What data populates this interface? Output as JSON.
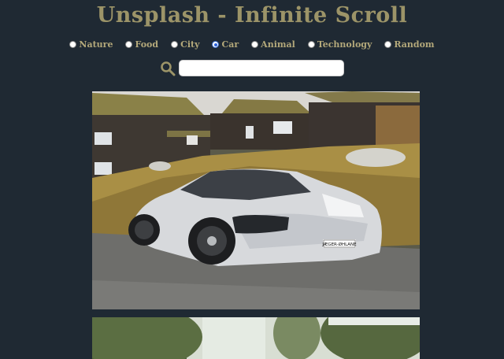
{
  "header": {
    "title": "Unsplash - Infinite Scroll"
  },
  "categories": {
    "items": [
      {
        "label": "Nature",
        "checked": false
      },
      {
        "label": "Food",
        "checked": false
      },
      {
        "label": "City",
        "checked": false
      },
      {
        "label": "Car",
        "checked": true
      },
      {
        "label": "Animal",
        "checked": false
      },
      {
        "label": "Technology",
        "checked": false
      },
      {
        "label": "Random",
        "checked": false
      }
    ]
  },
  "search": {
    "value": "",
    "placeholder": "",
    "icon": "search-icon"
  },
  "photos": [
    {
      "subject": "car-photo",
      "license_plate": "JÆGER-ØHLANE"
    },
    {
      "subject": "trees-photo"
    }
  ],
  "colors": {
    "background": "#1f2933",
    "title": "#9c9468",
    "label": "#b3a87a"
  }
}
